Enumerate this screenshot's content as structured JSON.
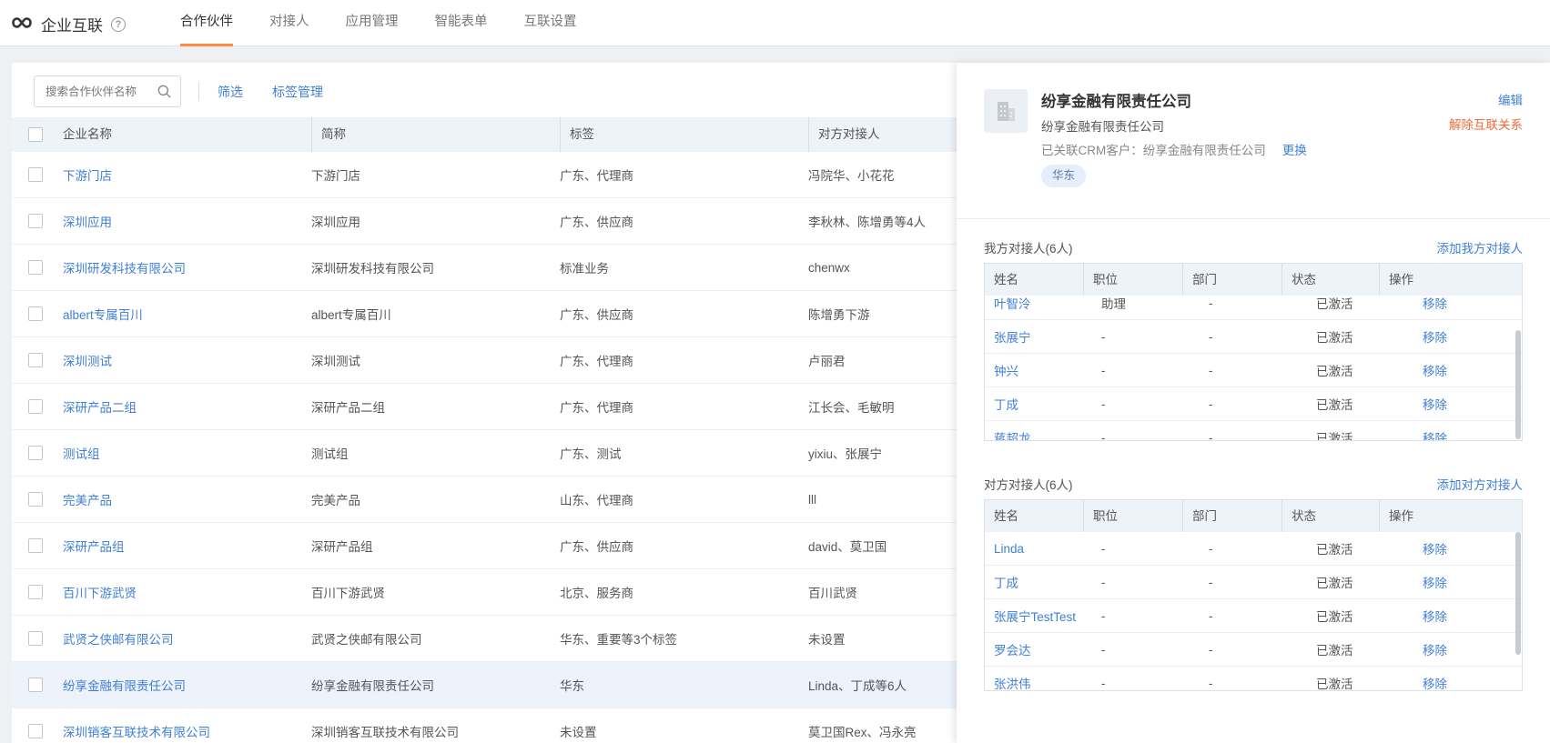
{
  "app": {
    "title": "企业互联",
    "help": "?"
  },
  "nav": {
    "tabs": [
      {
        "label": "合作伙伴",
        "active": true
      },
      {
        "label": "对接人",
        "active": false
      },
      {
        "label": "应用管理",
        "active": false
      },
      {
        "label": "智能表单",
        "active": false
      },
      {
        "label": "互联设置",
        "active": false
      }
    ]
  },
  "toolbar": {
    "search_placeholder": "搜索合作伙伴名称",
    "filter_label": "筛选",
    "tags_label": "标签管理"
  },
  "table": {
    "columns": [
      "企业名称",
      "简称",
      "标签",
      "对方对接人"
    ],
    "rows": [
      {
        "name": "下游门店",
        "short": "下游门店",
        "tags": "广东、代理商",
        "contact": "冯院华、小花花"
      },
      {
        "name": "深圳应用",
        "short": "深圳应用",
        "tags": "广东、供应商",
        "contact": "李秋林、陈增勇等4人"
      },
      {
        "name": "深圳研发科技有限公司",
        "short": "深圳研发科技有限公司",
        "tags": "标准业务",
        "contact": "chenwx"
      },
      {
        "name": "albert专属百川",
        "short": "albert专属百川",
        "tags": "广东、供应商",
        "contact": "陈增勇下游"
      },
      {
        "name": "深圳测试",
        "short": "深圳测试",
        "tags": "广东、代理商",
        "contact": "卢丽君"
      },
      {
        "name": "深研产品二组",
        "short": "深研产品二组",
        "tags": "广东、代理商",
        "contact": "江长会、毛敏明"
      },
      {
        "name": "测试组",
        "short": "测试组",
        "tags": "广东、测试",
        "contact": "yixiu、张展宁"
      },
      {
        "name": "完美产品",
        "short": "完美产品",
        "tags": "山东、代理商",
        "contact": "lll"
      },
      {
        "name": "深研产品组",
        "short": "深研产品组",
        "tags": "广东、供应商",
        "contact": "david、莫卫国"
      },
      {
        "name": "百川下游武贤",
        "short": "百川下游武贤",
        "tags": "北京、服务商",
        "contact": "百川武贤"
      },
      {
        "name": "武贤之侠邮有限公司",
        "short": "武贤之侠邮有限公司",
        "tags": "华东、重要等3个标签",
        "contact": "未设置"
      },
      {
        "name": "纷享金融有限责任公司",
        "short": "纷享金融有限责任公司",
        "tags": "华东",
        "contact": "Linda、丁成等6人",
        "selected": true
      },
      {
        "name": "深圳销客互联技术有限公司",
        "short": "深圳销客互联技术有限公司",
        "tags": "未设置",
        "contact": "莫卫国Rex、冯永亮"
      }
    ]
  },
  "detail": {
    "company_name": "纷享金融有限责任公司",
    "short_name": "纷享金融有限责任公司",
    "crm_label": "已关联CRM客户：纷享金融有限责任公司",
    "change_label": "更换",
    "tag": "华东",
    "edit_label": "编辑",
    "unlink_label": "解除互联关系",
    "our_contacts": {
      "title": "我方对接人(6人)",
      "add_label": "添加我方对接人",
      "columns": [
        "姓名",
        "职位",
        "部门",
        "状态",
        "操作"
      ],
      "rows": [
        {
          "name": "叶智泠",
          "position": "助理",
          "dept": "-",
          "status": "已激活",
          "op": "移除"
        },
        {
          "name": "张展宁",
          "position": "-",
          "dept": "-",
          "status": "已激活",
          "op": "移除"
        },
        {
          "name": "钟兴",
          "position": "-",
          "dept": "-",
          "status": "已激活",
          "op": "移除"
        },
        {
          "name": "丁成",
          "position": "-",
          "dept": "-",
          "status": "已激活",
          "op": "移除"
        },
        {
          "name": "蒋超龙",
          "position": "-",
          "dept": "-",
          "status": "已激活",
          "op": "移除"
        }
      ]
    },
    "their_contacts": {
      "title": "对方对接人(6人)",
      "add_label": "添加对方对接人",
      "columns": [
        "姓名",
        "职位",
        "部门",
        "状态",
        "操作"
      ],
      "rows": [
        {
          "name": "Linda",
          "position": "-",
          "dept": "-",
          "status": "已激活",
          "op": "移除"
        },
        {
          "name": "丁成",
          "position": "-",
          "dept": "-",
          "status": "已激活",
          "op": "移除"
        },
        {
          "name": "张展宁TestTest",
          "position": "-",
          "dept": "-",
          "status": "已激活",
          "op": "移除"
        },
        {
          "name": "罗会达",
          "position": "-",
          "dept": "-",
          "status": "已激活",
          "op": "移除"
        },
        {
          "name": "张洪伟",
          "position": "-",
          "dept": "-",
          "status": "已激活",
          "op": "移除"
        }
      ]
    }
  },
  "colors": {
    "accent": "#ff8a3d",
    "link": "#3f7fd6",
    "danger": "#f06b3a"
  }
}
